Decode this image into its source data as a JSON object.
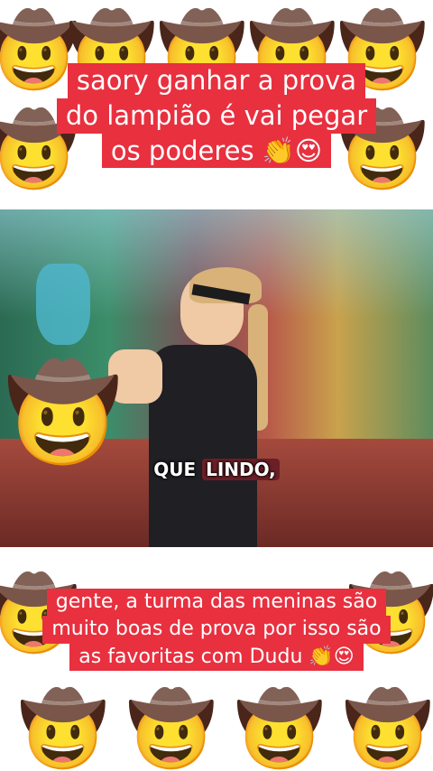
{
  "background": {
    "emoji_icon": "cowboy-face-icon",
    "glyph": "🤠"
  },
  "top_caption": {
    "lines": [
      "saory ganhar a prova",
      "do lampião é vai pegar",
      "os poderes 👏😍"
    ],
    "color_bg": "#e8303f",
    "color_text": "#ffffff"
  },
  "video": {
    "subtitle_word1": "QUE",
    "subtitle_word2": "LINDO,",
    "overlay_emoji": "🤠"
  },
  "bottom_caption": {
    "lines": [
      "gente, a turma das meninas são",
      "muito boas de prova por isso são",
      "as favoritas com Dudu 👏😍"
    ]
  }
}
